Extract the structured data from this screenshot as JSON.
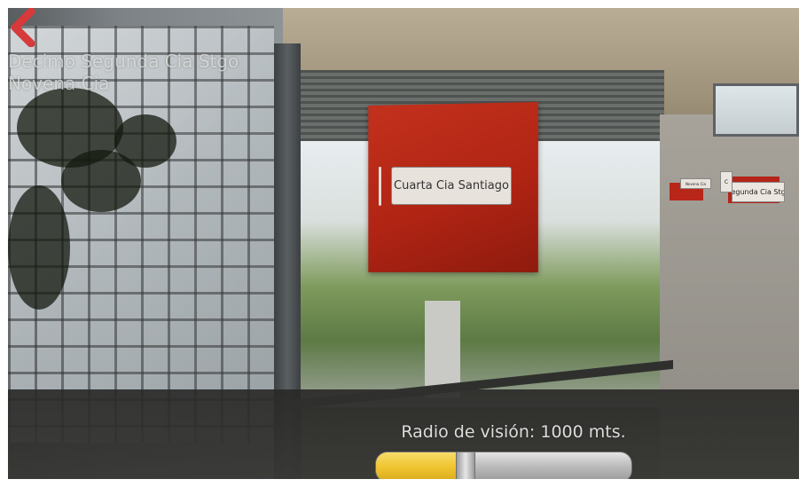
{
  "nav": {
    "back_icon": "chevron-left-icon",
    "back_color": "#d63a3a"
  },
  "poi_list": [
    "Decimo Segunda Cia Stgo",
    "Novena Cia"
  ],
  "ar_markers": {
    "main_label": "Cuarta Cia Santiago",
    "small_a_label": "Novena Cia",
    "small_b_label": "C",
    "small_c_label": "Segunda Cia Stgo",
    "marker_color": "#b8261a"
  },
  "radius": {
    "caption": "Radio de visión: 1000 mts.",
    "slider_fraction": 0.35,
    "fill_color": "#f0c531"
  }
}
